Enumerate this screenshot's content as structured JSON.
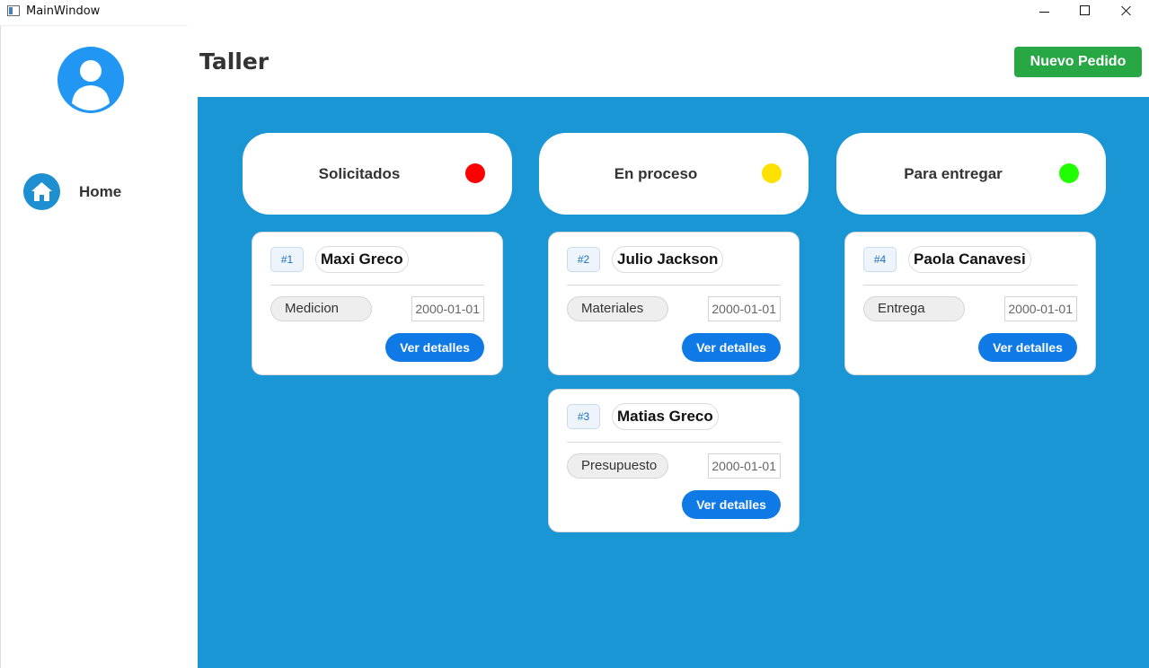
{
  "window": {
    "title": "MainWindow"
  },
  "sidebar": {
    "items": [
      {
        "label": "Home",
        "icon": "home-icon"
      }
    ]
  },
  "header": {
    "title": "Taller",
    "new_order_label": "Nuevo Pedido"
  },
  "columns": [
    {
      "label": "Solicitados",
      "status_color": "#ff0000"
    },
    {
      "label": "En proceso",
      "status_color": "#ffe100"
    },
    {
      "label": "Para entregar",
      "status_color": "#22ff00"
    }
  ],
  "orders": [
    {
      "number": "#1",
      "name": "Maxi Greco",
      "stage": "Medicion",
      "date": "2000-01-01",
      "details_label": "Ver detalles"
    },
    {
      "number": "#2",
      "name": "Julio Jackson",
      "stage": "Materiales",
      "date": "2000-01-01",
      "details_label": "Ver detalles"
    },
    {
      "number": "#3",
      "name": "Matias Greco",
      "stage": "Presupuesto",
      "date": "2000-01-01",
      "details_label": "Ver detalles"
    },
    {
      "number": "#4",
      "name": "Paola Canavesi",
      "stage": "Entrega",
      "date": "2000-01-01",
      "details_label": "Ver detalles"
    }
  ],
  "colors": {
    "board": "#1996d3",
    "accent": "#0f7ae5",
    "new_order": "#28a745",
    "avatar": "#2196f3"
  }
}
